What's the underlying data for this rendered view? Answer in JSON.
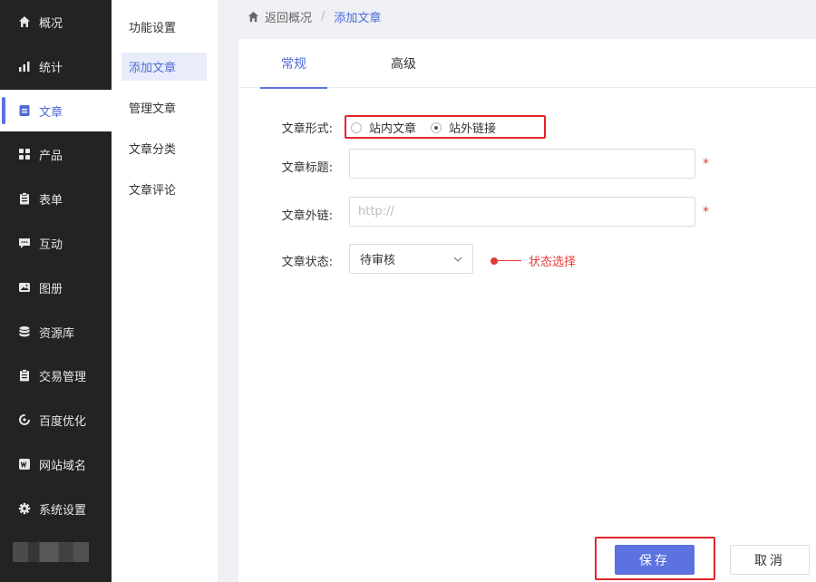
{
  "sidebar": {
    "items": [
      {
        "label": "概况",
        "icon": "home-icon"
      },
      {
        "label": "统计",
        "icon": "chart-icon"
      },
      {
        "label": "文章",
        "icon": "article-icon",
        "active": true
      },
      {
        "label": "产品",
        "icon": "grid-icon"
      },
      {
        "label": "表单",
        "icon": "clipboard-icon"
      },
      {
        "label": "互动",
        "icon": "chat-icon"
      },
      {
        "label": "图册",
        "icon": "image-icon"
      },
      {
        "label": "资源库",
        "icon": "database-icon"
      },
      {
        "label": "交易管理",
        "icon": "clipboard-icon"
      },
      {
        "label": "百度优化",
        "icon": "refresh-icon"
      },
      {
        "label": "网站域名",
        "icon": "web-icon"
      },
      {
        "label": "系统设置",
        "icon": "gear-icon"
      }
    ]
  },
  "subnav": {
    "items": [
      "功能设置",
      "添加文章",
      "管理文章",
      "文章分类",
      "文章评论"
    ],
    "active_index": 1
  },
  "breadcrumb": {
    "back": "返回概况",
    "current": "添加文章"
  },
  "tabs": [
    "常规",
    "高级"
  ],
  "form": {
    "type_label": "文章形式:",
    "type_options": [
      "站内文章",
      "站外链接"
    ],
    "type_selected": 1,
    "title_label": "文章标题:",
    "title_value": "",
    "link_label": "文章外链:",
    "link_placeholder": "http://",
    "status_label": "文章状态:",
    "status_value": "待审核",
    "required_mark": "*",
    "annotation": "状态选择"
  },
  "actions": {
    "save": "保存",
    "cancel": "取消"
  },
  "colors": {
    "accent": "#5b72e0",
    "sidebar_bg": "#232323",
    "highlight_red": "#e0262a"
  }
}
